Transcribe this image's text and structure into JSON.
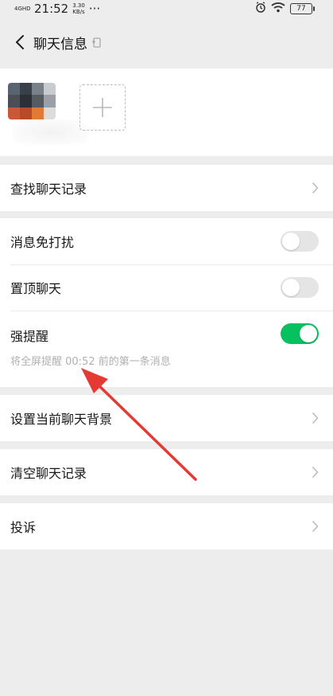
{
  "status_bar": {
    "network": "4GHD",
    "time": "21:52",
    "speed_value": "3.30",
    "speed_unit": "KB/s",
    "more": "···",
    "battery": "77"
  },
  "nav": {
    "title": "聊天信息"
  },
  "members": {
    "add_label": "+"
  },
  "menu": {
    "find_history": "查找聊天记录",
    "mute": {
      "label": "消息免打扰",
      "enabled": false
    },
    "pin": {
      "label": "置顶聊天",
      "enabled": false
    },
    "strong_reminder": {
      "label": "强提醒",
      "enabled": true,
      "hint": "将全屏提醒 00:52 前的第一条消息"
    },
    "set_background": "设置当前聊天背景",
    "clear_history": "清空聊天记录",
    "report": "投诉"
  },
  "colors": {
    "accent_green": "#07c160",
    "annotation_red": "#e53935"
  }
}
